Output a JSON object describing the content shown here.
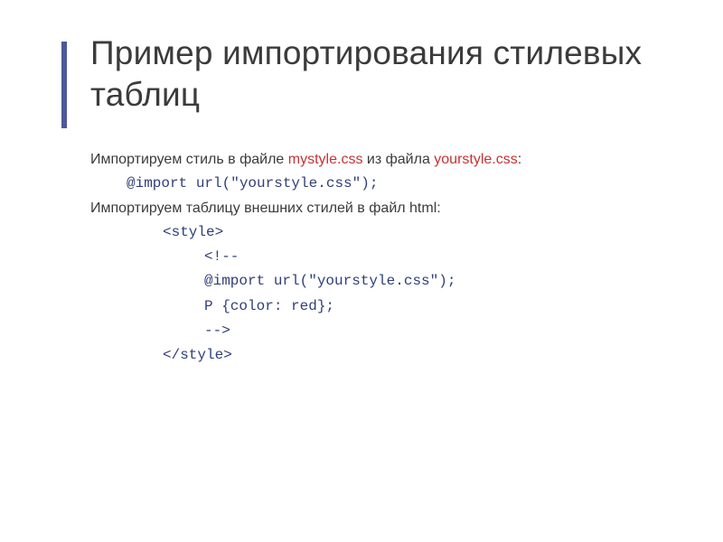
{
  "title": "Пример импортирования стилевых таблиц",
  "line1_a": "Импортируем стиль в файле ",
  "line1_file1": "mystyle.css",
  "line1_b": " из файла ",
  "line1_file2": "yourstyle.css",
  "line1_c": ":",
  "code1": "@import url(\"yourstyle.css\");",
  "line2": "Импортируем таблицу внешних стилей в файл html:",
  "code2_l1": "<style>",
  "code2_l2": "<!--",
  "code2_l3": "@import url(\"yourstyle.css\");",
  "code2_l4": "P {color: red};",
  "code2_l5": "-->",
  "code2_l6": "</style>"
}
